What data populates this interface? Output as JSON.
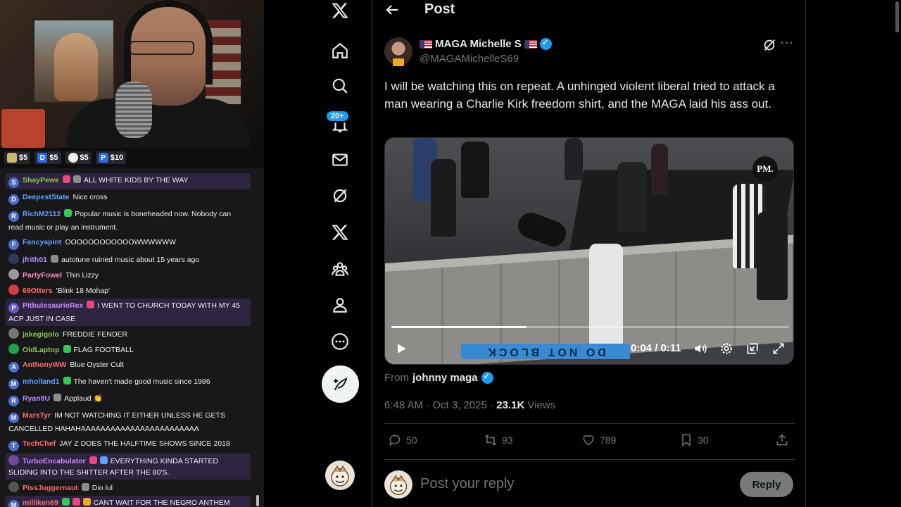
{
  "stream": {
    "donations": [
      {
        "icon": "coin",
        "label": "$5"
      },
      {
        "icon": "D",
        "label": "$5"
      },
      {
        "icon": "circle",
        "label": "$5"
      },
      {
        "icon": "P",
        "label": "$10"
      }
    ],
    "chat": [
      {
        "user": "ShayPewe",
        "color": "#8bc34a",
        "avatar": "S",
        "avatar_color": "#4a6ec9",
        "badges": [
          "#e9497a",
          "#8d8d8d"
        ],
        "text": "ALL WHITE KIDS BY THE WAY",
        "highlight": true
      },
      {
        "user": "DeepestState",
        "color": "#5ea1ff",
        "avatar": "D",
        "avatar_color": "#4a6ec9",
        "badges": [],
        "text": "Nice cross",
        "highlight": false
      },
      {
        "user": "RichM2112",
        "color": "#5ea1ff",
        "avatar": "R",
        "avatar_color": "#4a6ec9",
        "badges": [
          "#34c759"
        ],
        "text": "Popular music is boneheaded now. Nobody can read music or play an instrument.",
        "highlight": false
      },
      {
        "user": "Fancyapint",
        "color": "#5ea1ff",
        "avatar": "F",
        "avatar_color": "#4a6ec9",
        "badges": [],
        "text": "OOOOOOOOOOOOWWWWWW",
        "highlight": false
      },
      {
        "user": "jfrith01",
        "color": "#b48cff",
        "avatar": "",
        "avatar_color": "#2e3a5c",
        "badges": [
          "#8d8d8d"
        ],
        "text": "autotune ruined music about 15 years ago",
        "highlight": false
      },
      {
        "user": "PartyFowel",
        "color": "#ff8cc6",
        "avatar": "",
        "avatar_color": "#9a9a9a",
        "badges": [],
        "text": "Thin Lizzy",
        "highlight": false
      },
      {
        "user": "69Otters",
        "color": "#ff6b6b",
        "avatar": "",
        "avatar_color": "#d23b3b",
        "badges": [],
        "text": "'Blink 18 Mohap'",
        "highlight": false
      },
      {
        "user": "PitbulosaurioRex",
        "color": "#c58cff",
        "avatar": "P",
        "avatar_color": "#6b57c9",
        "badges": [
          "#e9497a"
        ],
        "text": "I WENT TO CHURCH TODAY WITH MY 45 ACP JUST IN CASE",
        "highlight": true
      },
      {
        "user": "jakegigolo",
        "color": "#8bc34a",
        "avatar": "",
        "avatar_color": "#777",
        "badges": [],
        "text": "FREDDIE FENDER",
        "highlight": false
      },
      {
        "user": "OldLaptop",
        "color": "#8bc34a",
        "avatar": "",
        "avatar_color": "#1fa34a",
        "badges": [
          "#34c759"
        ],
        "text": "FLAG FOOTBALL",
        "highlight": false
      },
      {
        "user": "AnthonyWW",
        "color": "#ff6b6b",
        "avatar": "A",
        "avatar_color": "#4a6ec9",
        "badges": [],
        "text": "Blue Oyster Cult",
        "highlight": false
      },
      {
        "user": "mholland1",
        "color": "#5ea1ff",
        "avatar": "M",
        "avatar_color": "#4a6ec9",
        "badges": [
          "#34c759"
        ],
        "text": "The haven't made good music since 1986",
        "highlight": false
      },
      {
        "user": "Ryan8U",
        "color": "#b48cff",
        "avatar": "R",
        "avatar_color": "#4a6ec9",
        "badges": [
          "#8d8d8d"
        ],
        "text": "Applaud 👏",
        "highlight": false
      },
      {
        "user": "MarsTyr",
        "color": "#ff6b6b",
        "avatar": "M",
        "avatar_color": "#4a6ec9",
        "badges": [],
        "text": "IM NOT WATCHING IT EITHER UNLESS HE GETS CANCELLED HAHAHAAAAAAAAAAAAAAAAAAAAAAAA",
        "highlight": false
      },
      {
        "user": "TechChef",
        "color": "#ff6b6b",
        "avatar": "T",
        "avatar_color": "#4a6ec9",
        "badges": [],
        "text": "JAY Z DOES THE HALFTIME SHOWS SINCE 2018",
        "highlight": false
      },
      {
        "user": "TurboEncabulator",
        "color": "#c58cff",
        "avatar": "",
        "avatar_color": "#6b4a9b",
        "badges": [
          "#e9497a",
          "#5ea1ff"
        ],
        "text": "EVERYTHING KINDA STARTED SLIDING INTO THE SHITTER AFTER THE 80'S.",
        "highlight": true
      },
      {
        "user": "PissJuggernaut",
        "color": "#ff6b6b",
        "avatar": "",
        "avatar_color": "#555",
        "badges": [
          "#8d8d8d"
        ],
        "text": "Dio lul",
        "highlight": false
      },
      {
        "user": "milliken69",
        "color": "#ff6b6b",
        "avatar": "M",
        "avatar_color": "#4a6ec9",
        "badges": [
          "#34c759",
          "#e9497a",
          "#f5a623"
        ],
        "text": "CANT WAIT FOR THE NEGRO ANTHEM",
        "highlight": true
      }
    ]
  },
  "nav": {
    "notifications_badge": "20+"
  },
  "post": {
    "page_title": "Post",
    "author_name": "MAGA Michelle S",
    "author_handle": "@MAGAMichelleS69",
    "text": "I will be watching this on repeat.  A unhinged violent liberal tried to attack a man wearing a Charlie Kirk freedom shirt, and the MAGA laid his ass out.",
    "video": {
      "watermark": "PM.",
      "banner_text": "DO NOT BLOCK",
      "time_readout": "0:04 / 0:11",
      "progress": 0.34
    },
    "from_label": "From",
    "from_name": "johnny maga",
    "timestamp": "6:48 AM · Oct 3, 2025",
    "views_count": "23.1K",
    "views_label": "Views",
    "stats": {
      "replies": "50",
      "reposts": "93",
      "likes": "789",
      "bookmarks": "30"
    },
    "reply_placeholder": "Post your reply",
    "reply_button": "Reply"
  },
  "colors": {
    "accent": "#1d9bf0",
    "muted": "#71767b",
    "border": "#2f3336"
  }
}
